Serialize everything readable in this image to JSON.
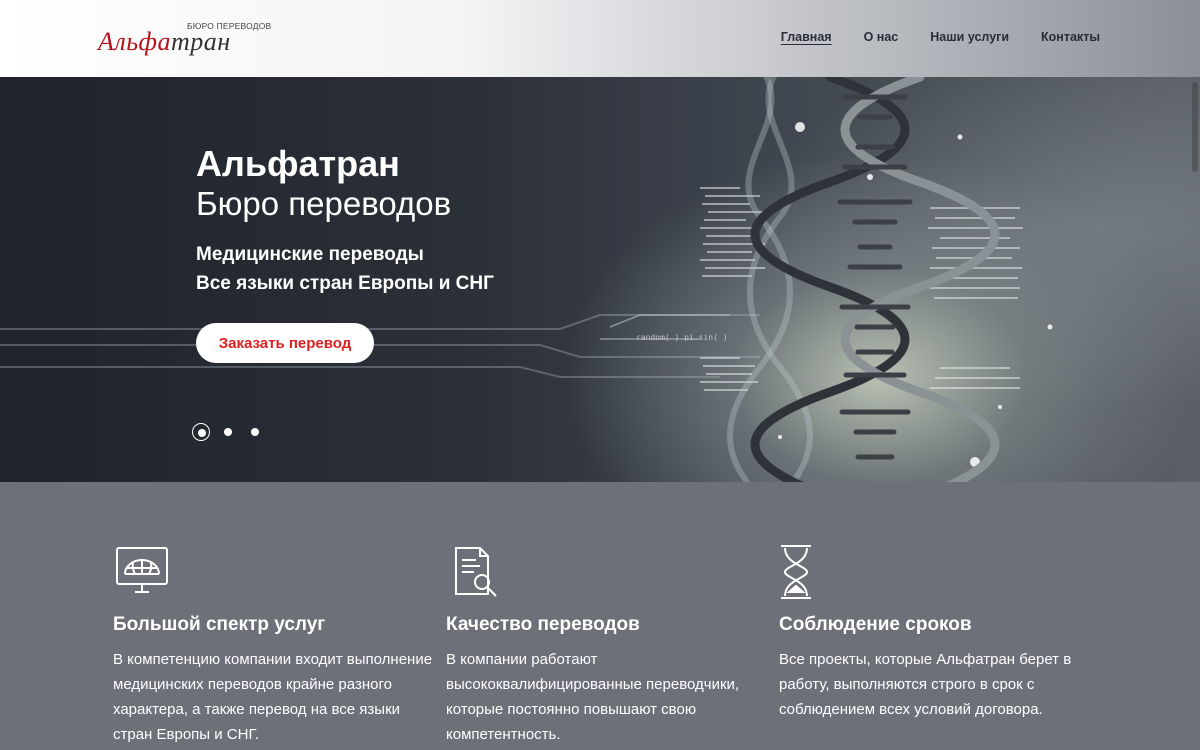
{
  "header": {
    "logo": {
      "subtitle": "БЮРО ПЕРЕВОДОВ",
      "name_red": "Альфа",
      "name_dark": "тран"
    },
    "nav": [
      {
        "label": "Главная",
        "active": true
      },
      {
        "label": "О нас",
        "active": false
      },
      {
        "label": "Наши услуги",
        "active": false
      },
      {
        "label": "Контакты",
        "active": false
      }
    ]
  },
  "hero": {
    "title": "Альфатран",
    "subtitle": "Бюро переводов",
    "line1": "Медицинские переводы",
    "line2": "Все языки стран Европы и СНГ",
    "cta_label": "Заказать перевод",
    "decor_text": "random( ) pi.sin( )",
    "slider_dots": 3,
    "active_slide": 1
  },
  "features": [
    {
      "icon": "monitor-globe-icon",
      "title": "Большой спектр услуг",
      "text": "В компетенцию компании входит выполнение медицинских переводов крайне разного характера, а также перевод на все языки стран Европы и СНГ."
    },
    {
      "icon": "document-magnifier-icon",
      "title": "Качество переводов",
      "text": "В компании работают высококвалифицированные переводчики, которые постоянно повышают свою компетентность."
    },
    {
      "icon": "hourglass-icon",
      "title": "Соблюдение сроков",
      "text": "Все проекты, которые Альфатран берет в работу, выполняются строго в срок с соблюдением всех условий договора."
    }
  ],
  "colors": {
    "brand_red": "#b4131b",
    "cta_text": "#e02020",
    "features_bg": "#6d7079",
    "hero_dark": "#1f232b"
  }
}
